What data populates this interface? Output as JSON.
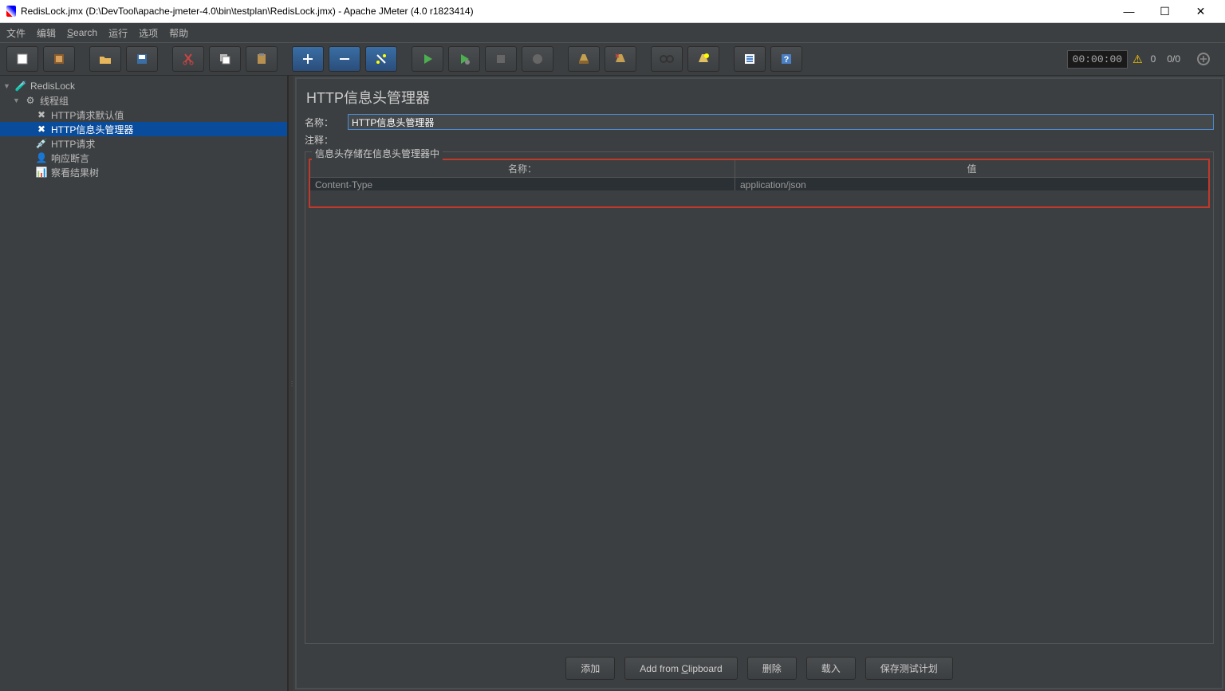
{
  "window": {
    "title": "RedisLock.jmx (D:\\DevTool\\apache-jmeter-4.0\\bin\\testplan\\RedisLock.jmx) - Apache JMeter (4.0 r1823414)"
  },
  "menu": {
    "file": "文件",
    "edit": "编辑",
    "search": "Search",
    "run": "运行",
    "options": "选项",
    "help": "帮助"
  },
  "toolbar_status": {
    "timer": "00:00:00",
    "warn_count": "0",
    "thread_status": "0/0"
  },
  "tree": {
    "root": "RedisLock",
    "thread_group": "线程组",
    "items": [
      {
        "label": "HTTP请求默认值"
      },
      {
        "label": "HTTP信息头管理器",
        "selected": true
      },
      {
        "label": "HTTP请求"
      },
      {
        "label": "响应断言"
      },
      {
        "label": "察看结果树"
      }
    ]
  },
  "panel": {
    "title": "HTTP信息头管理器",
    "name_label": "名称：",
    "name_value": "HTTP信息头管理器",
    "comment_label": "注释：",
    "fieldset_legend": "信息头存储在信息头管理器中",
    "table": {
      "col_name": "名称：",
      "col_value": "值",
      "rows": [
        {
          "name": "Content-Type",
          "value": "application/json"
        }
      ]
    },
    "buttons": {
      "add": "添加",
      "add_clip": "Add from Clipboard",
      "delete": "删除",
      "load": "载入",
      "save": "保存测试计划"
    }
  }
}
